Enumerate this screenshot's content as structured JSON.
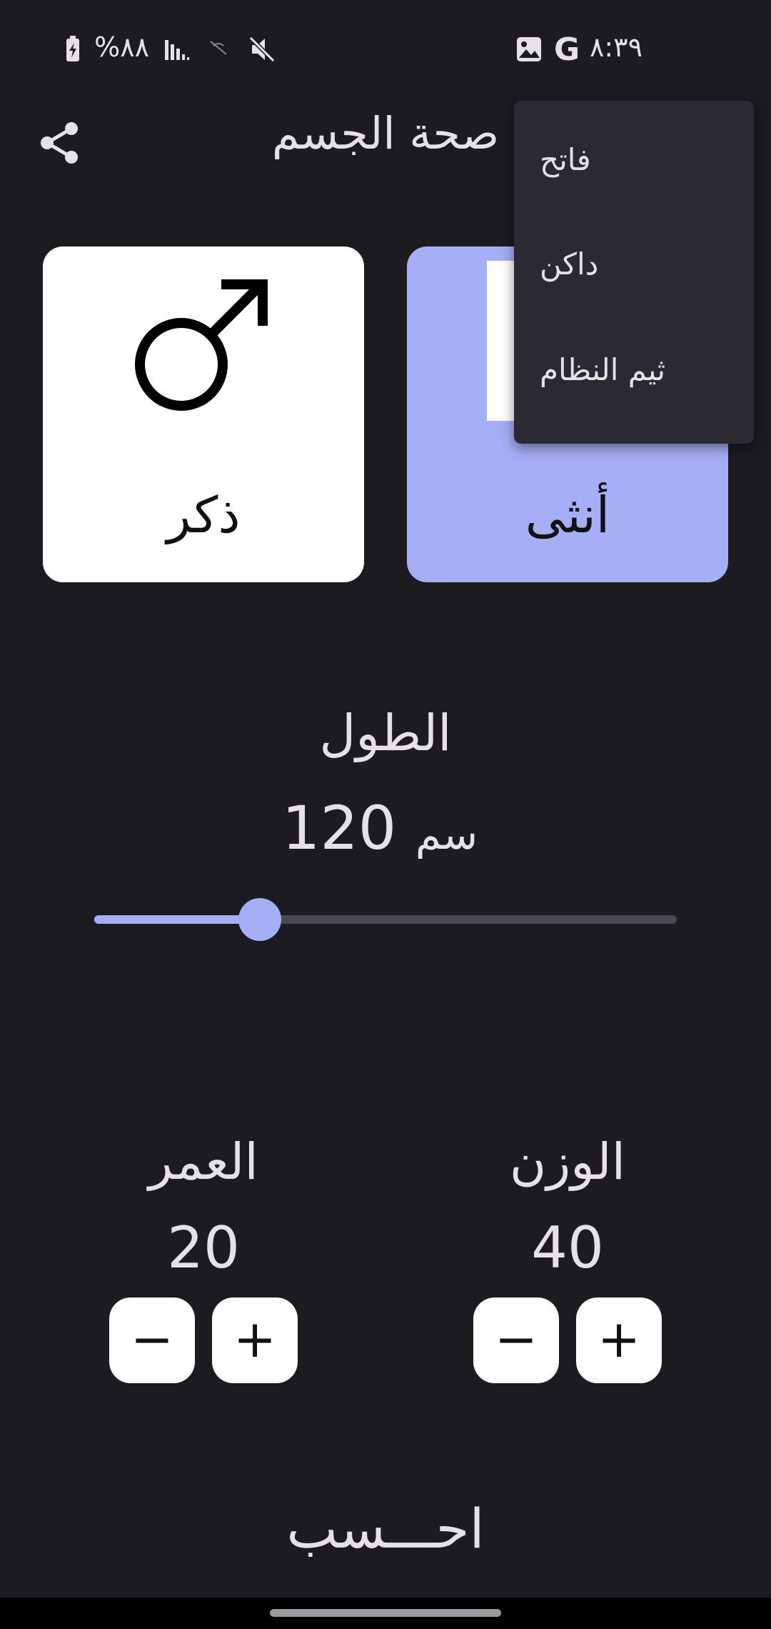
{
  "status_bar": {
    "time": "٨:٣٩",
    "battery": "%٨٨"
  },
  "app_bar": {
    "title": "صحة الجسم",
    "share_icon": "share-icon"
  },
  "gender": {
    "male_label": "ذكر",
    "female_label": "أنثى",
    "selected": "female",
    "selected_color": "#a6aef5"
  },
  "theme_menu": {
    "items": [
      "فاتح",
      "داكن",
      "ثيم النظام"
    ]
  },
  "height": {
    "label": "الطول",
    "value": "120",
    "unit": "سم",
    "slider_fraction": 0.285
  },
  "weight": {
    "label": "الوزن",
    "value": "40"
  },
  "age": {
    "label": "العمر",
    "value": "20"
  },
  "stepper": {
    "minus": "−",
    "plus": "+"
  },
  "calculate_label": "احـــسب"
}
